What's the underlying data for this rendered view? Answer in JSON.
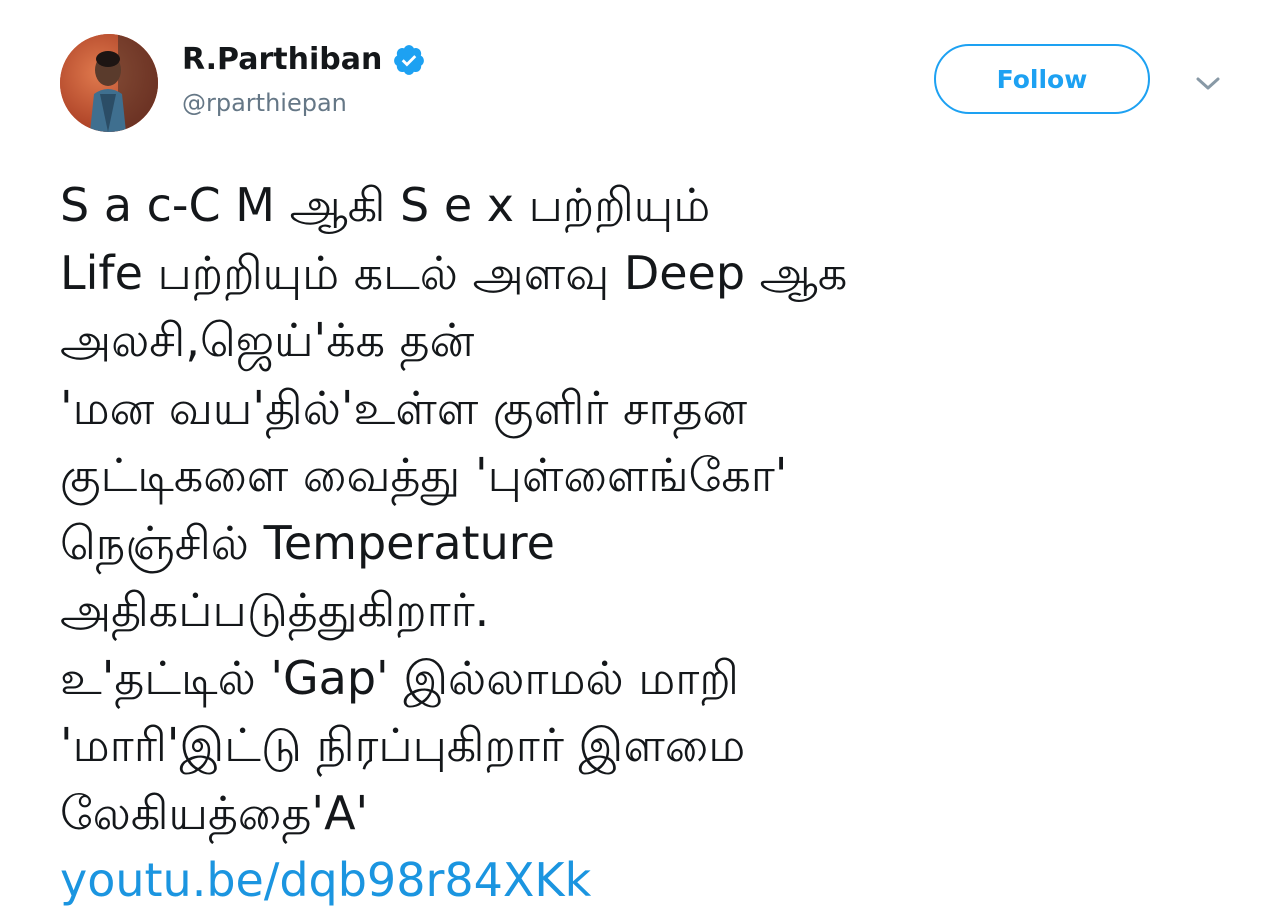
{
  "user": {
    "display_name": "R.Parthiban",
    "handle": "@rparthiepan",
    "verified": true
  },
  "actions": {
    "follow_label": "Follow"
  },
  "tweet": {
    "lines": [
      "S a c-C M ஆகி S e x பற்றியும்",
      "Life பற்றியும் கடல் அளவு Deep ஆக",
      "அலசி,ஜெய்'க்க தன்",
      "'மன வய'தில்'உள்ள குளிர் சாதன",
      "குட்டிகளை வைத்து 'புள்ளைங்கோ'",
      "நெஞ்சில் Temperature",
      "அதிகப்படுத்துகிறார்.",
      "உ'தட்டில் 'Gap' இல்லாமல் மாறி",
      "'மாரி'இட்டு நிரப்புகிறார் இளமை",
      "லேகியத்தை'A'"
    ],
    "link": "youtu.be/dqb98r84XKk"
  },
  "colors": {
    "accent": "#1da1f2",
    "link": "#1b95e0",
    "handle": "#657786",
    "text": "#14171a"
  },
  "icons": {
    "verified": "verified-badge-icon",
    "caret": "chevron-down-icon"
  }
}
